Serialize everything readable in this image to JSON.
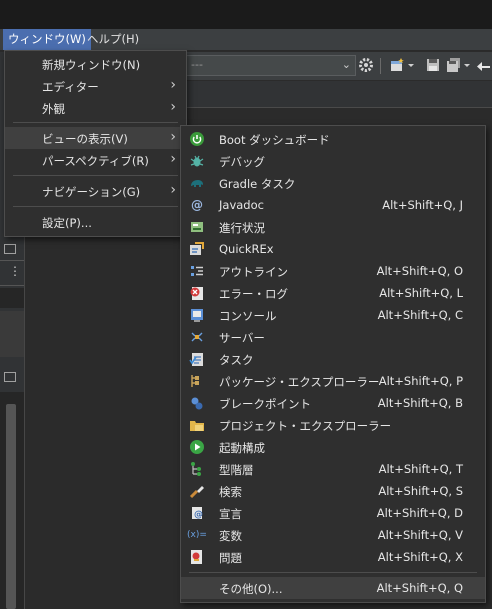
{
  "menubar": {
    "window": "ウィンドウ(W)",
    "help": "ヘルプ(H)"
  },
  "toolbar": {
    "combo_value": "---"
  },
  "window_menu": {
    "items": [
      {
        "label": "新規ウィンドウ(N)",
        "submenu": false
      },
      {
        "label": "エディター",
        "submenu": true
      },
      {
        "label": "外観",
        "submenu": true
      },
      {
        "label": "ビューの表示(V)",
        "submenu": true,
        "highlighted": true
      },
      {
        "label": "パースペクティブ(R)",
        "submenu": true
      },
      {
        "label": "ナビゲーション(G)",
        "submenu": true
      },
      {
        "label": "設定(P)...",
        "submenu": false
      }
    ]
  },
  "show_view_menu": {
    "items": [
      {
        "label": "Boot ダッシュボード",
        "shortcut": "",
        "icon": "boot-dashboard-icon"
      },
      {
        "label": "デバッグ",
        "shortcut": "",
        "icon": "debug-bug-icon"
      },
      {
        "label": "Gradle タスク",
        "shortcut": "",
        "icon": "gradle-elephant-icon"
      },
      {
        "label": "Javadoc",
        "shortcut": "Alt+Shift+Q, J",
        "icon": "javadoc-at-icon"
      },
      {
        "label": "進行状況",
        "shortcut": "",
        "icon": "progress-icon"
      },
      {
        "label": "QuickREx",
        "shortcut": "",
        "icon": "quickrex-icon"
      },
      {
        "label": "アウトライン",
        "shortcut": "Alt+Shift+Q, O",
        "icon": "outline-icon"
      },
      {
        "label": "エラー・ログ",
        "shortcut": "Alt+Shift+Q, L",
        "icon": "error-log-icon"
      },
      {
        "label": "コンソール",
        "shortcut": "Alt+Shift+Q, C",
        "icon": "console-icon"
      },
      {
        "label": "サーバー",
        "shortcut": "",
        "icon": "servers-icon"
      },
      {
        "label": "タスク",
        "shortcut": "",
        "icon": "tasks-icon"
      },
      {
        "label": "パッケージ・エクスプローラー",
        "shortcut": "Alt+Shift+Q, P",
        "icon": "package-explorer-icon"
      },
      {
        "label": "ブレークポイント",
        "shortcut": "Alt+Shift+Q, B",
        "icon": "breakpoints-icon"
      },
      {
        "label": "プロジェクト・エクスプローラー",
        "shortcut": "",
        "icon": "project-explorer-icon"
      },
      {
        "label": "起動構成",
        "shortcut": "",
        "icon": "launch-config-icon"
      },
      {
        "label": "型階層",
        "shortcut": "Alt+Shift+Q, T",
        "icon": "type-hierarchy-icon"
      },
      {
        "label": "検索",
        "shortcut": "Alt+Shift+Q, S",
        "icon": "search-icon"
      },
      {
        "label": "宣言",
        "shortcut": "Alt+Shift+Q, D",
        "icon": "declaration-icon"
      },
      {
        "label": "変数",
        "shortcut": "Alt+Shift+Q, V",
        "icon": "variables-icon"
      },
      {
        "label": "問題",
        "shortcut": "Alt+Shift+Q, X",
        "icon": "problems-icon"
      }
    ],
    "other": {
      "label": "その他(O)...",
      "shortcut": "Alt+Shift+Q, Q"
    }
  }
}
